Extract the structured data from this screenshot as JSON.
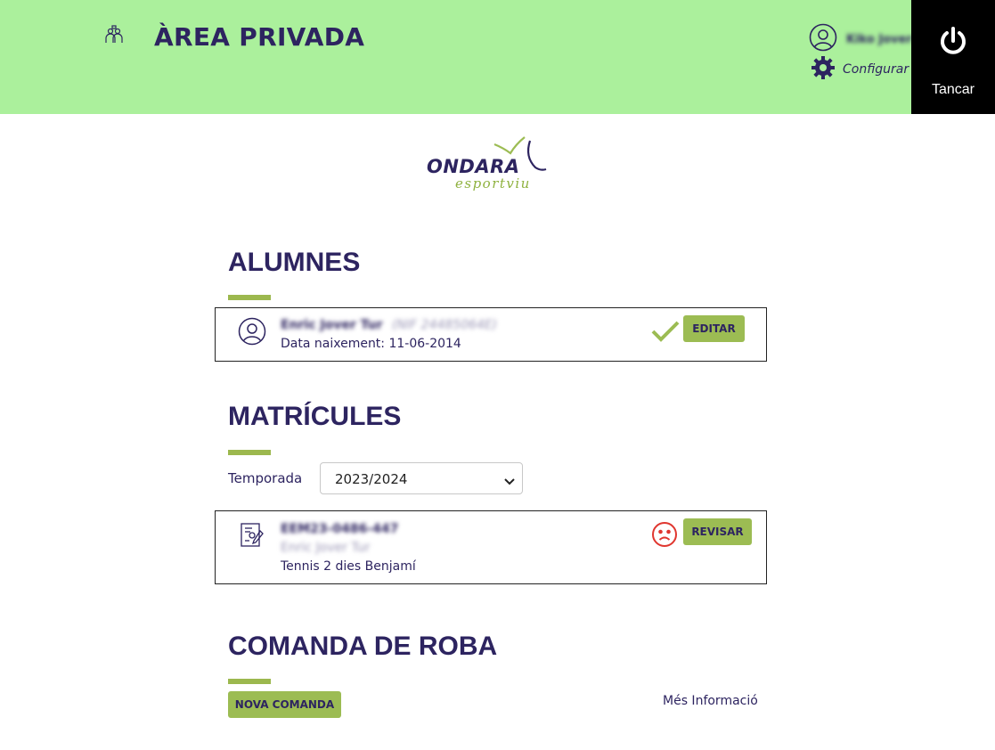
{
  "header": {
    "title": "ÀREA PRIVADA",
    "user_name": "Kiko Jover",
    "config_label": "Configurar",
    "logout_label": "Tancar"
  },
  "logo": {
    "brand": "ONDARA",
    "tagline": "esportviu"
  },
  "alumnes": {
    "title": "ALUMNES",
    "student": {
      "name": "Enric Jover Tur",
      "nif": "(NIF 24485064E)",
      "birth": "Data naixement: 11-06-2014",
      "status_icon": "check-icon",
      "edit_label": "EDITAR"
    }
  },
  "matricules": {
    "title": "MATRÍCULES",
    "season_label": "Temporada",
    "season_value": "2023/2024",
    "enrollment": {
      "code": "EEM23-0486-447",
      "student": "Enric Jover Tur",
      "course": "Tennis 2 dies Benjamí",
      "status_icon": "sad-face-icon",
      "review_label": "REVISAR"
    }
  },
  "comanda": {
    "title": "COMANDA DE ROBA",
    "new_order_label": "NOVA COMANDA",
    "more_info_label": "Més Informació"
  },
  "colors": {
    "header_bg": "#abf09c",
    "primary_text": "#2d2460",
    "accent_green": "#9cbc53",
    "alert_red": "#e0362f"
  }
}
